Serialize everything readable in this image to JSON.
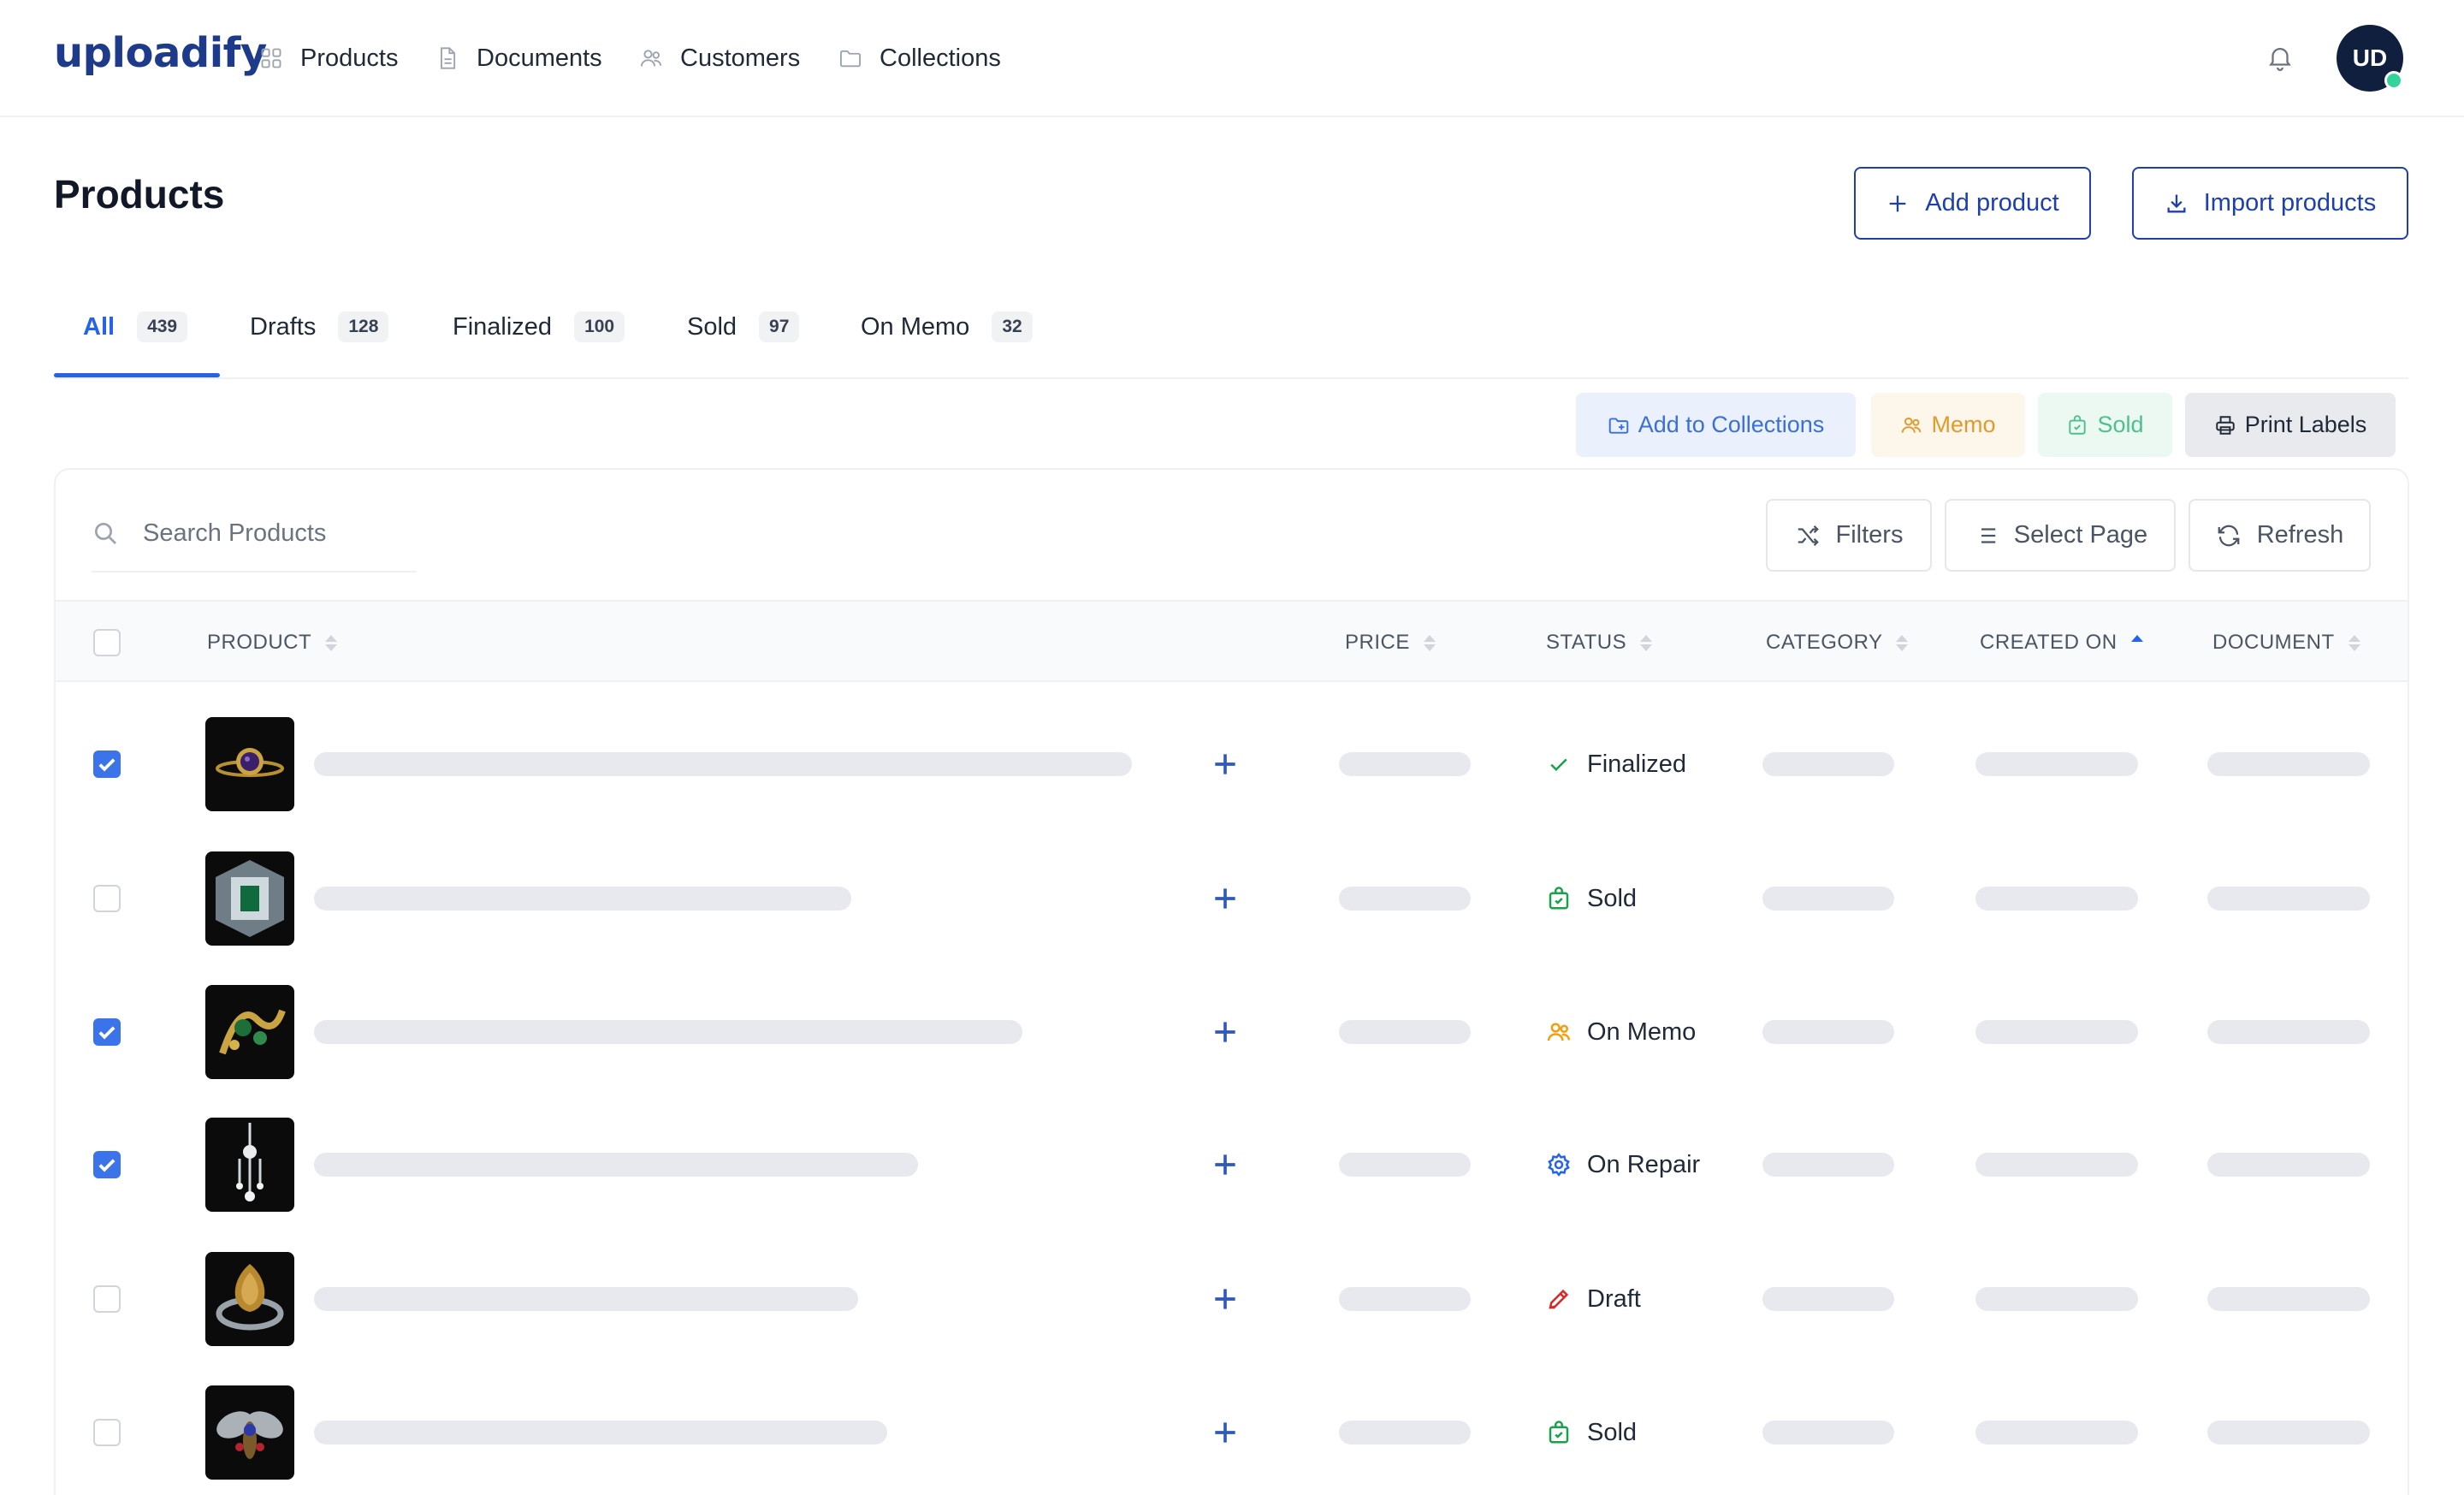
{
  "app": {
    "logo": "uploadify",
    "avatar_initials": "UD"
  },
  "nav": [
    {
      "label": "Products",
      "icon": "grid-icon"
    },
    {
      "label": "Documents",
      "icon": "document-icon"
    },
    {
      "label": "Customers",
      "icon": "users-icon"
    },
    {
      "label": "Collections",
      "icon": "folder-icon"
    }
  ],
  "header": {
    "title": "Products",
    "add_label": "Add product",
    "import_label": "Import products"
  },
  "tabs": [
    {
      "label": "All",
      "count": "439",
      "active": true
    },
    {
      "label": "Drafts",
      "count": "128"
    },
    {
      "label": "Finalized",
      "count": "100"
    },
    {
      "label": "Sold",
      "count": "97"
    },
    {
      "label": "On Memo",
      "count": "32"
    }
  ],
  "bulk_actions": {
    "collections": "Add to Collections",
    "memo": "Memo",
    "sold": "Sold",
    "print": "Print Labels"
  },
  "toolbar": {
    "search_placeholder": "Search Products",
    "filters": "Filters",
    "select_page": "Select Page",
    "refresh": "Refresh"
  },
  "columns": {
    "product": "PRODUCT",
    "price": "PRICE",
    "status": "STATUS",
    "category": "CATEGORY",
    "created_on": "CREATED ON",
    "document": "DOCUMENT"
  },
  "sort": {
    "column": "CREATED ON",
    "direction": "ascending"
  },
  "rows": [
    {
      "checked": true,
      "status": "Finalized",
      "status_icon": "check-icon",
      "status_color": "#16a34a"
    },
    {
      "checked": false,
      "status": "Sold",
      "status_icon": "bag-icon",
      "status_color": "#16a34a"
    },
    {
      "checked": true,
      "status": "On Memo",
      "status_icon": "users-icon",
      "status_color": "#f59e0b"
    },
    {
      "checked": true,
      "status": "On Repair",
      "status_icon": "gear-icon",
      "status_color": "#2563eb"
    },
    {
      "checked": false,
      "status": "Draft",
      "status_icon": "pencil-icon",
      "status_color": "#dc2626"
    },
    {
      "checked": false,
      "status": "Sold",
      "status_icon": "bag-icon",
      "status_color": "#16a34a"
    }
  ],
  "colors": {
    "brand": "#1e3a8a",
    "accent": "#2563eb",
    "checkbox": "#3b74ea",
    "online": "#34d399"
  }
}
